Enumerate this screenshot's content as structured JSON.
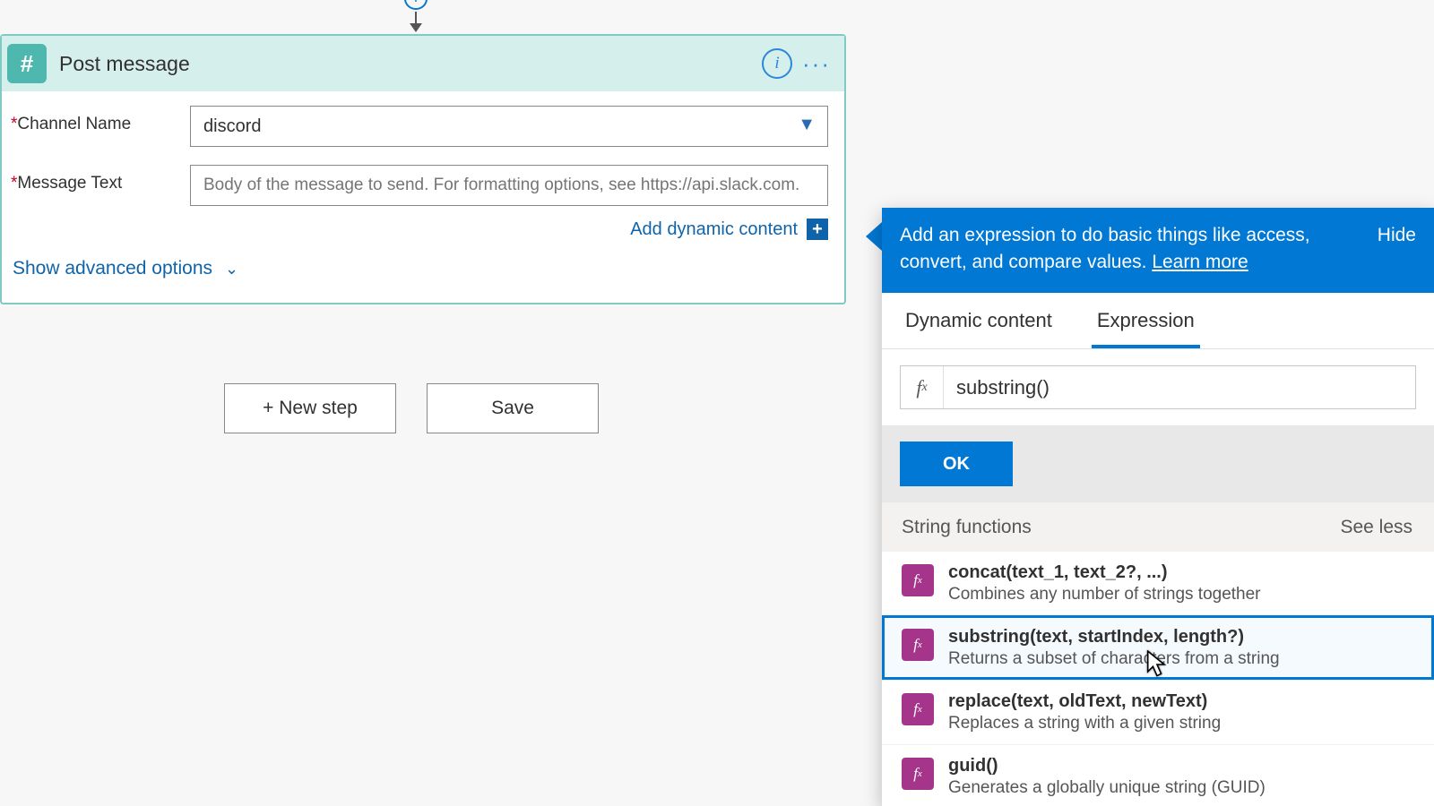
{
  "card": {
    "title": "Post message",
    "fields": {
      "channel": {
        "label": "Channel Name",
        "value": "discord"
      },
      "message": {
        "label": "Message Text",
        "placeholder": "Body of the message to send. For formatting options, see https://api.slack.com."
      }
    },
    "add_dynamic_label": "Add dynamic content",
    "advanced_label": "Show advanced options"
  },
  "buttons": {
    "new_step": "+ New step",
    "save": "Save"
  },
  "flyout": {
    "banner_text": "Add an expression to do basic things like access, convert, and compare values. ",
    "learn_more": "Learn more",
    "hide": "Hide",
    "tabs": {
      "dynamic": "Dynamic content",
      "expression": "Expression"
    },
    "expression_value": "substring()",
    "ok": "OK",
    "group_title": "String functions",
    "see_less": "See less",
    "functions": [
      {
        "sig": "concat(text_1, text_2?, ...)",
        "desc": "Combines any number of strings together",
        "selected": false
      },
      {
        "sig": "substring(text, startIndex, length?)",
        "desc": "Returns a subset of characters from a string",
        "selected": true
      },
      {
        "sig": "replace(text, oldText, newText)",
        "desc": "Replaces a string with a given string",
        "selected": false
      },
      {
        "sig": "guid()",
        "desc": "Generates a globally unique string (GUID)",
        "selected": false
      }
    ]
  }
}
